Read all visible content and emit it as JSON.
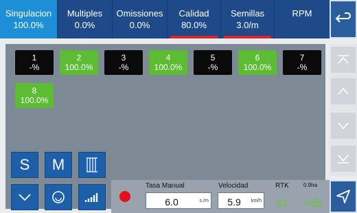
{
  "tabs": [
    {
      "label": "Singulacion",
      "value": "100.0%",
      "active": true,
      "underline": false
    },
    {
      "label": "Multiples",
      "value": "0.0%",
      "active": false,
      "underline": false
    },
    {
      "label": "Omissiones",
      "value": "0.0%",
      "active": false,
      "underline": false
    },
    {
      "label": "Calidad",
      "value": "80.0%",
      "active": false,
      "underline": true
    },
    {
      "label": "Semillas",
      "value": "3.0/m",
      "active": false,
      "underline": true
    },
    {
      "label": "RPM",
      "value": "",
      "active": false,
      "underline": false
    }
  ],
  "rows": [
    {
      "num": "1",
      "value": "-%",
      "status": "black"
    },
    {
      "num": "2",
      "value": "100.0%",
      "status": "green"
    },
    {
      "num": "3",
      "value": "-%",
      "status": "black"
    },
    {
      "num": "4",
      "value": "100.0%",
      "status": "green"
    },
    {
      "num": "5",
      "value": "-%",
      "status": "black"
    },
    {
      "num": "6",
      "value": "100.0%",
      "status": "green"
    },
    {
      "num": "7",
      "value": "-%",
      "status": "black"
    },
    {
      "num": "8",
      "value": "100.0%",
      "status": "green"
    }
  ],
  "tools": {
    "s_label": "S",
    "m_label": "M"
  },
  "controls": {
    "tasa_label": "Tasa Manual",
    "tasa_value": "6.0",
    "tasa_unit": "s./m",
    "velocidad_label": "Velocidad",
    "velocidad_value": "5.9",
    "velocidad_unit": "km/h",
    "rtk_label": "RTK",
    "area_label": "0.9ha"
  },
  "colors": {
    "tab_bar": "#1f4a8a",
    "tab_active": "#1d8fd6",
    "ok_green": "#5cbd35",
    "record_red": "#e3101c",
    "underline": "#d9262c"
  }
}
